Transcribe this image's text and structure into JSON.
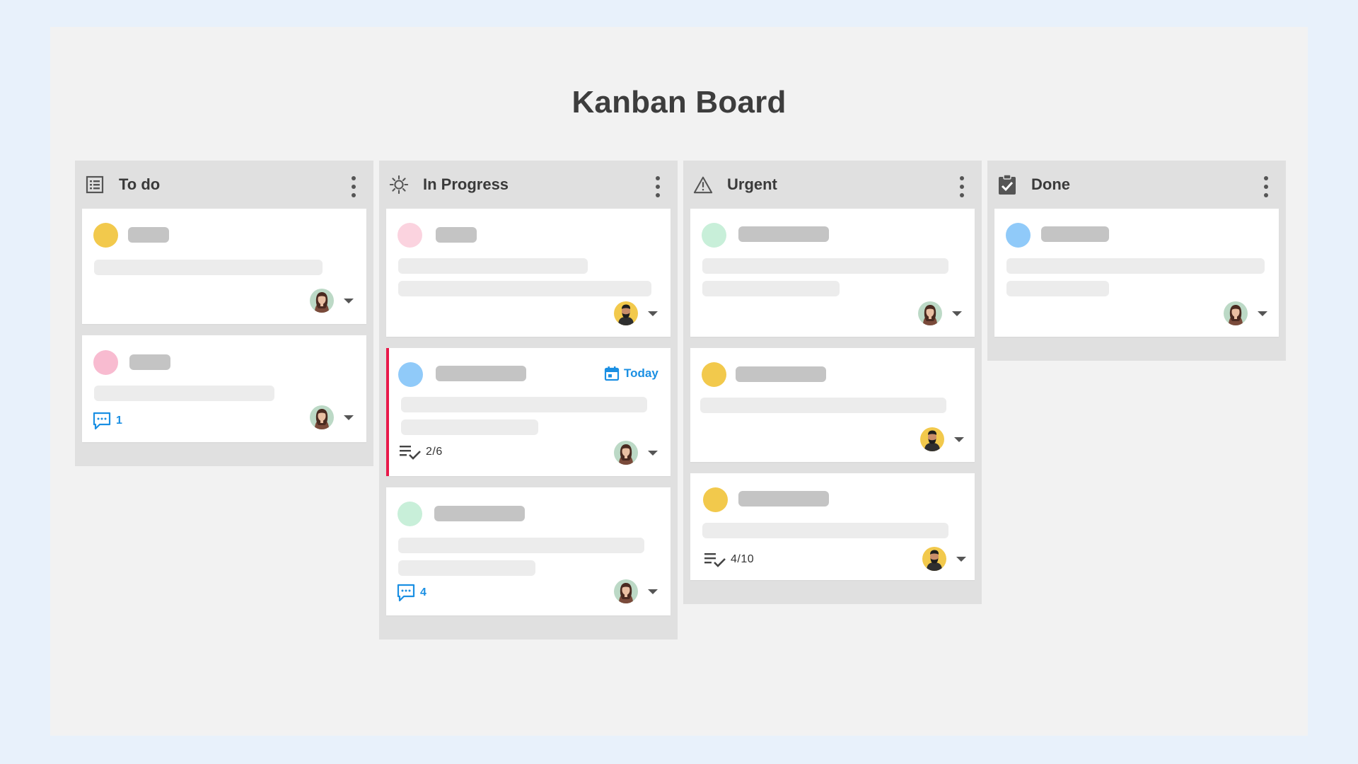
{
  "board": {
    "title": "Kanban Board"
  },
  "colors": {
    "yellow": "#f2c94c",
    "pink": "#f8bbd0",
    "pink_light": "#fbd3df",
    "blue": "#90caf9",
    "mint": "#c8efd9",
    "accent_blue": "#1a8fe3",
    "flag_red": "#e8194a"
  },
  "columns": [
    {
      "title": "To do",
      "icon": "list-icon",
      "cards": [
        {
          "dot": "yellow",
          "assignee": "woman-avatar"
        },
        {
          "dot": "pink",
          "assignee": "woman-avatar",
          "comments": "1"
        }
      ]
    },
    {
      "title": "In Progress",
      "icon": "sun-icon",
      "cards": [
        {
          "dot": "pink_light",
          "assignee": "man-avatar"
        },
        {
          "dot": "blue",
          "assignee": "woman-avatar",
          "due": "Today",
          "checklist": "2/6",
          "flagged": true
        },
        {
          "dot": "mint",
          "assignee": "woman-avatar",
          "comments": "4"
        }
      ]
    },
    {
      "title": "Urgent",
      "icon": "warning-icon",
      "cards": [
        {
          "dot": "mint",
          "assignee": "woman-avatar"
        },
        {
          "dot": "yellow",
          "assignee": "man-avatar"
        },
        {
          "dot": "yellow",
          "assignee": "man-avatar",
          "checklist": "4/10"
        }
      ]
    },
    {
      "title": "Done",
      "icon": "clipboard-check-icon",
      "cards": [
        {
          "dot": "blue",
          "assignee": "woman-avatar"
        }
      ]
    }
  ]
}
